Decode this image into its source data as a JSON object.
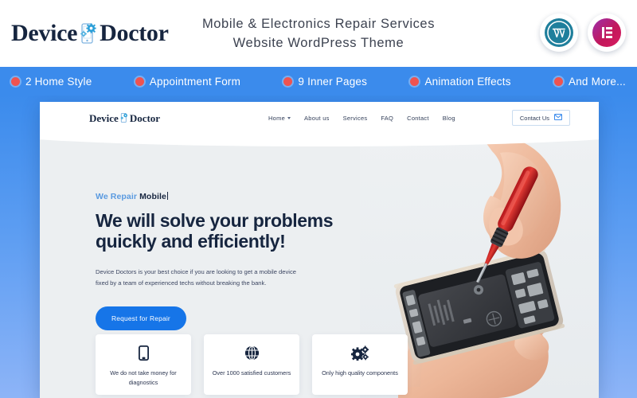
{
  "header": {
    "brand_left": "Device",
    "brand_right": "Doctor",
    "brand_icon": "phone-gears-icon",
    "title_line1": "Mobile & Electronics Repair Services",
    "title_line2": "Website WordPress Theme",
    "badges": [
      {
        "name": "wordpress-badge",
        "glyph": "W"
      },
      {
        "name": "elementor-badge",
        "glyph": "E"
      }
    ]
  },
  "feature_bar": {
    "background": "#3b8bec",
    "dot_color": "#ef5350",
    "items": [
      {
        "label": "2 Home Style"
      },
      {
        "label": "Appointment Form"
      },
      {
        "label": "9 Inner Pages"
      },
      {
        "label": "Animation Effects"
      },
      {
        "label": "And More..."
      }
    ]
  },
  "preview": {
    "nav": {
      "logo_left": "Device",
      "logo_right": "Doctor",
      "menu": [
        {
          "label": "Home",
          "has_dropdown": true
        },
        {
          "label": "About us",
          "has_dropdown": false
        },
        {
          "label": "Services",
          "has_dropdown": false
        },
        {
          "label": "FAQ",
          "has_dropdown": false
        },
        {
          "label": "Contact",
          "has_dropdown": false
        },
        {
          "label": "Blog",
          "has_dropdown": false
        }
      ],
      "contact_button": "Contact Us",
      "contact_icon": "envelope-icon"
    },
    "hero": {
      "eyebrow_light": "We Repair ",
      "eyebrow_dark": "Mobile",
      "title_line1": "We will solve your problems",
      "title_line2": "quickly and efficiently!",
      "description": "Device Doctors is your best choice if you are looking to get a mobile device fixed by a team of experienced techs without breaking the bank.",
      "cta_label": "Request for Repair",
      "cta_color": "#1675e8",
      "photo_alt": "hands-repairing-phone-photo"
    },
    "cards": [
      {
        "icon": "mobile-phone-icon",
        "text": "We do not take money for diagnostics"
      },
      {
        "icon": "globe-icon",
        "text": "Over 1000 satisfied customers"
      },
      {
        "icon": "gears-icon",
        "text": "Only high quality components"
      }
    ]
  },
  "colors": {
    "accent_blue": "#3b8bec",
    "navy": "#16253f",
    "coral": "#ef5350"
  }
}
